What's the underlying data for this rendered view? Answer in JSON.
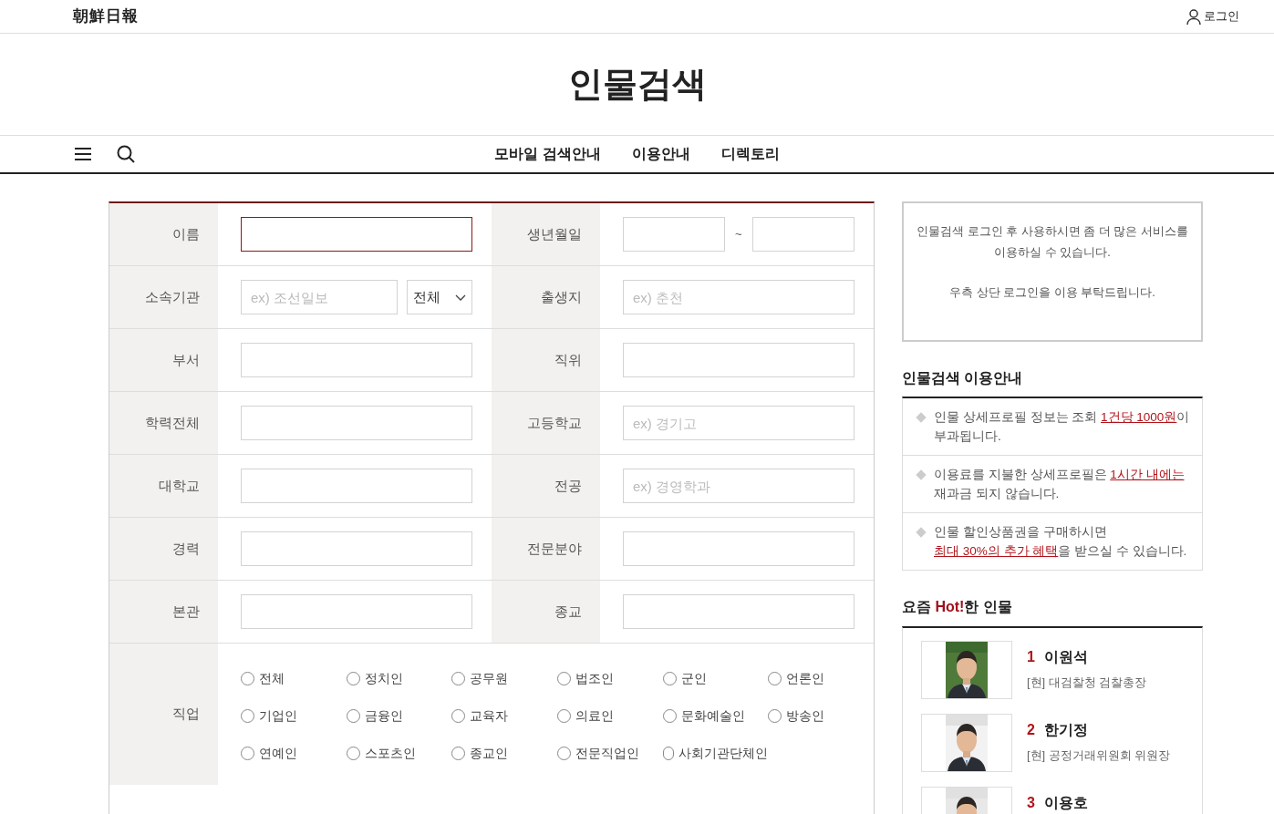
{
  "header": {
    "logo": "朝鮮日報",
    "login": "로그인",
    "title": "인물검색"
  },
  "nav": [
    "모바일 검색안내",
    "이용안내",
    "디렉토리"
  ],
  "form": {
    "rows": [
      [
        {
          "label": "이름",
          "kind": "text",
          "focused": true
        },
        {
          "label": "생년월일",
          "kind": "range",
          "separator": "~"
        }
      ],
      [
        {
          "label": "소속기관",
          "kind": "org",
          "placeholder": "ex) 조선일보",
          "select": "전체"
        },
        {
          "label": "출생지",
          "kind": "text",
          "placeholder": "ex) 춘천",
          "focused": false
        }
      ],
      [
        {
          "label": "부서",
          "kind": "text",
          "focused": false
        },
        {
          "label": "직위",
          "kind": "text",
          "focused": false
        }
      ],
      [
        {
          "label": "학력전체",
          "kind": "text",
          "focused": false
        },
        {
          "label": "고등학교",
          "kind": "text",
          "placeholder": "ex) 경기고",
          "focused": false
        }
      ],
      [
        {
          "label": "대학교",
          "kind": "text",
          "focused": false
        },
        {
          "label": "전공",
          "kind": "text",
          "placeholder": "ex) 경영학과",
          "focused": false
        }
      ],
      [
        {
          "label": "경력",
          "kind": "text",
          "focused": false
        },
        {
          "label": "전문분야",
          "kind": "text",
          "focused": false
        }
      ],
      [
        {
          "label": "본관",
          "kind": "text",
          "focused": false
        },
        {
          "label": "종교",
          "kind": "text",
          "focused": false
        }
      ]
    ],
    "occupation": {
      "label": "직업",
      "options": [
        {
          "label": "전체",
          "selected": false
        },
        {
          "label": "정치인",
          "selected": false
        },
        {
          "label": "공무원",
          "selected": false
        },
        {
          "label": "법조인",
          "selected": false
        },
        {
          "label": "군인",
          "selected": false
        },
        {
          "label": "언론인",
          "selected": false
        },
        {
          "label": "기업인",
          "selected": false
        },
        {
          "label": "금융인",
          "selected": false
        },
        {
          "label": "교육자",
          "selected": false
        },
        {
          "label": "의료인",
          "selected": false
        },
        {
          "label": "문화예술인",
          "selected": false
        },
        {
          "label": "방송인",
          "selected": false
        },
        {
          "label": "연예인",
          "selected": false
        },
        {
          "label": "스포츠인",
          "selected": false
        },
        {
          "label": "종교인",
          "selected": false
        },
        {
          "label": "전문직업인",
          "selected": false
        },
        {
          "label": "사회기관단체인",
          "selected": false
        }
      ]
    }
  },
  "notice": [
    "인물검색 로그인 후 사용하시면 좀 더 많은 서비스를 이용하실 수 있습니다.",
    "우측 상단 로그인을 이용 부탁드립니다."
  ],
  "guide": {
    "title": "인물검색 이용안내",
    "items": [
      [
        {
          "text": "인물 상세프로필 정보는 조회 ",
          "link": false
        },
        {
          "text": "1건당 1000원",
          "link": true
        },
        {
          "text": "이 부과됩니다.",
          "link": false
        }
      ],
      [
        {
          "text": "이용료를 지불한 상세프로필은 ",
          "link": false
        },
        {
          "text": "1시간 내에는",
          "link": true
        },
        {
          "text": " 재과금 되지 않습니다.",
          "link": false
        }
      ],
      [
        {
          "text": "인물 할인상품권을 구매하시면 ",
          "link": false
        },
        {
          "text": "최대 30%의 추가 혜택",
          "link": true
        },
        {
          "text": "을 받으실 수 있습니다.",
          "link": false
        }
      ]
    ]
  },
  "hot": {
    "title": [
      {
        "text": "요즘 ",
        "accent": false
      },
      {
        "text": "Hot!",
        "accent": true
      },
      {
        "text": "한 인물",
        "accent": false
      }
    ],
    "people": [
      {
        "rank": "1",
        "name": "이원석",
        "position": "[현] 대검찰청 검찰총장"
      },
      {
        "rank": "2",
        "name": "한기정",
        "position": "[현] 공정거래위원회 위원장"
      },
      {
        "rank": "3",
        "name": "이용호"
      }
    ]
  }
}
